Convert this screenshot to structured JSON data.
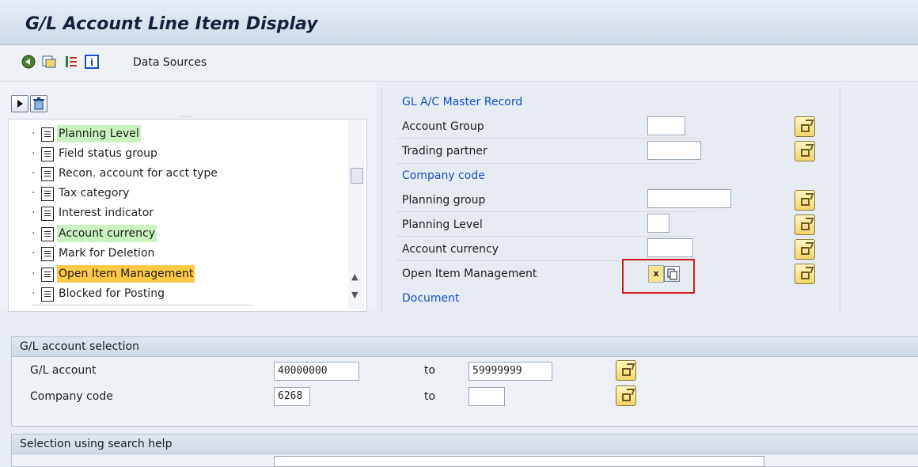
{
  "app": {
    "title": "G/L Account Line Item Display"
  },
  "toolbar": {
    "data_sources_label": "Data Sources"
  },
  "tree": {
    "items": [
      {
        "label": "Planning Level",
        "highlight": "green"
      },
      {
        "label": "Field status group",
        "highlight": ""
      },
      {
        "label": "Recon. account for acct type",
        "highlight": ""
      },
      {
        "label": "Tax category",
        "highlight": ""
      },
      {
        "label": "Interest indicator",
        "highlight": ""
      },
      {
        "label": "Account currency",
        "highlight": "green"
      },
      {
        "label": "Mark for Deletion",
        "highlight": ""
      },
      {
        "label": "Open Item Management",
        "highlight": "orange"
      },
      {
        "label": "Blocked for Posting",
        "highlight": ""
      }
    ]
  },
  "fields_panel": {
    "section_gl_master": "GL A/C Master Record",
    "account_group": "Account Group",
    "trading_partner": "Trading partner",
    "section_company_code": "Company code",
    "planning_group": "Planning group",
    "planning_level": "Planning Level",
    "account_currency": "Account currency",
    "open_item_management": "Open Item Management",
    "open_item_value": "x",
    "section_document": "Document"
  },
  "gl_selection": {
    "heading": "G/L account selection",
    "gl_account_label": "G/L account",
    "gl_account_from": "40000000",
    "to1": "to",
    "gl_account_to": "59999999",
    "company_code_label": "Company code",
    "company_code_from": "6268",
    "to2": "to",
    "company_code_to": ""
  },
  "search_help": {
    "heading": "Selection using search help"
  },
  "colors": {
    "highlight_green": "#c9f2c0",
    "highlight_orange": "#ffc845",
    "link_blue": "#1a4fc4",
    "callout_red": "#d11f1f"
  }
}
